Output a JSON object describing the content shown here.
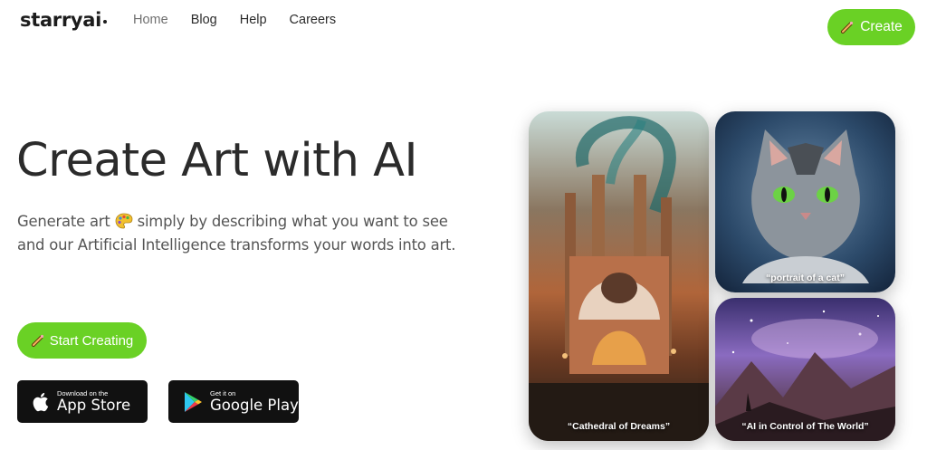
{
  "brand": {
    "name": "starryai"
  },
  "nav": {
    "items": [
      {
        "label": "Home"
      },
      {
        "label": "Blog"
      },
      {
        "label": "Help"
      },
      {
        "label": "Careers"
      }
    ]
  },
  "header": {
    "create_label": "Create"
  },
  "hero": {
    "title": "Create Art with AI",
    "subtitle_part1": "Generate art",
    "subtitle_part2": "simply by describing what you want to see and our Artificial Intelligence transforms your words into art.",
    "start_label": "Start Creating"
  },
  "stores": {
    "apple": {
      "small": "Download on the",
      "big": "App Store"
    },
    "google": {
      "small": "Get it on",
      "big": "Google Play"
    }
  },
  "gallery": [
    {
      "caption": "“Cathedral of Dreams”"
    },
    {
      "caption": "“portrait of a cat”"
    },
    {
      "caption": "“AI in Control of The World”"
    }
  ],
  "colors": {
    "accent": "#6ad125",
    "text": "#2b2b2b",
    "store_bg": "#111111"
  }
}
